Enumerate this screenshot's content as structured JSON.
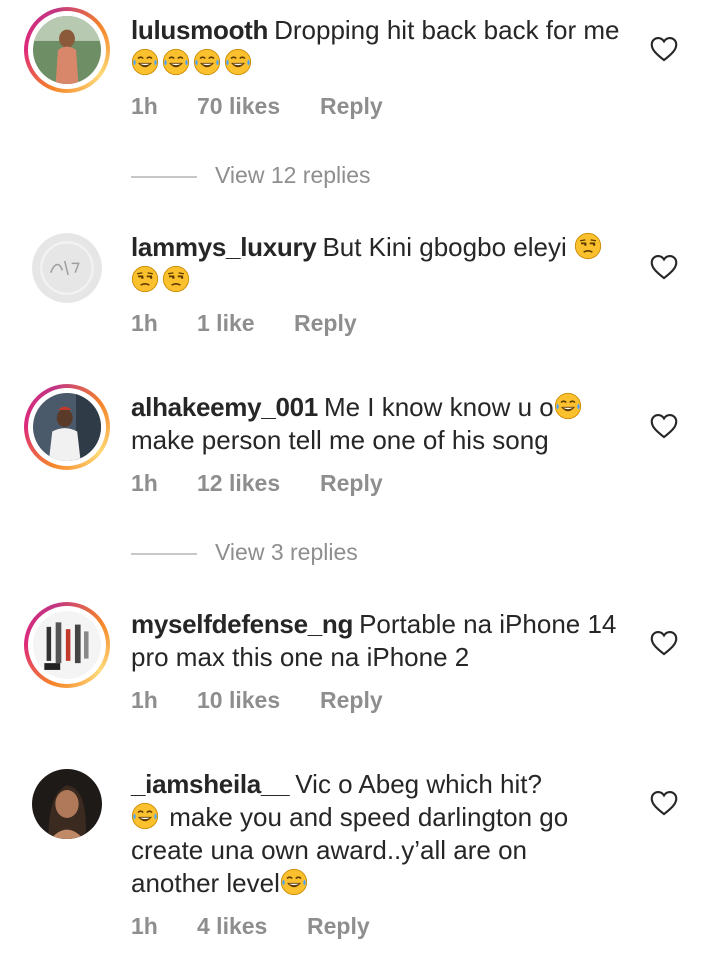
{
  "comments": [
    {
      "username": "lulusmooth",
      "text_before": "Dropping hit back back for me ",
      "emojis": [
        "joy",
        "joy",
        "joy",
        "joy"
      ],
      "text_after": "",
      "time": "1h",
      "likes": "70 likes",
      "reply": "Reply",
      "replies_link": "View 12 replies"
    },
    {
      "username": "lammys_luxury",
      "text_before": "But Kini gbogbo eleyi ",
      "emojis": [
        "unamused",
        "unamused",
        "unamused"
      ],
      "text_after": "",
      "time": "1h",
      "likes": "1 like",
      "reply": "Reply",
      "replies_link": ""
    },
    {
      "username": "alhakeemy_001",
      "text_before": "Me I know know u o",
      "emojis": [
        "joy"
      ],
      "text_after": "make person tell me one of his song",
      "time": "1h",
      "likes": "12 likes",
      "reply": "Reply",
      "replies_link": "View 3 replies"
    },
    {
      "username": "myselfdefense_ng",
      "text_before": "Portable na iPhone 14 pro max this one na iPhone 2",
      "emojis": [],
      "text_after": "",
      "time": "1h",
      "likes": "10 likes",
      "reply": "Reply",
      "replies_link": ""
    },
    {
      "username": "_iamsheila__",
      "text_before": "Vic o Abeg which hit?",
      "emojis": [
        "joy"
      ],
      "text_after": "make you and speed darlington go create una own award..y’all are on another level",
      "trailing_emoji": "joy",
      "time": "1h",
      "likes": "4 likes",
      "reply": "Reply",
      "replies_link": ""
    }
  ],
  "icons": {
    "like": "heart-outline-icon",
    "emoji_joy": "face-with-tears-of-joy",
    "emoji_unamused": "unamused-face"
  },
  "colors": {
    "text": "#262626",
    "muted": "#8e8e8e",
    "emoji": "#fbc02d"
  }
}
